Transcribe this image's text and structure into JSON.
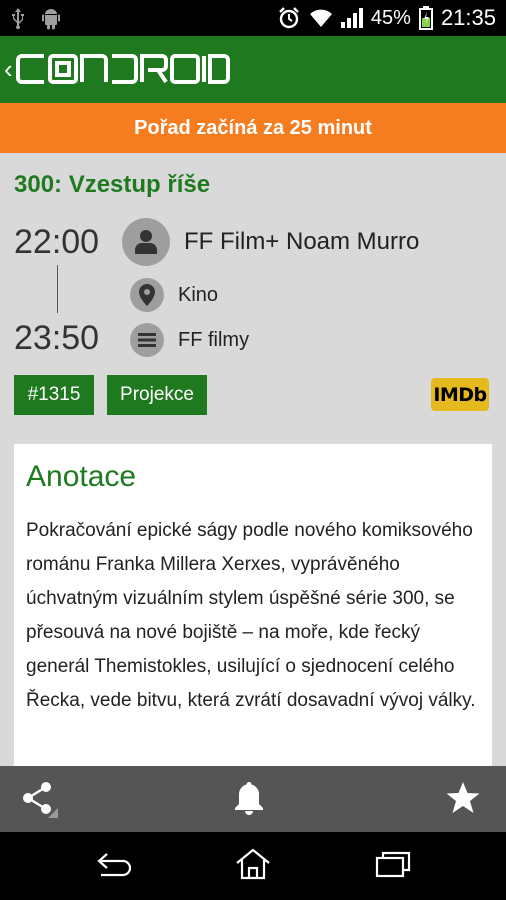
{
  "status_bar": {
    "battery_percent": "45%",
    "time": "21:35",
    "icons": [
      "usb-icon",
      "android-icon",
      "alarm-icon",
      "wifi-icon",
      "signal-icon",
      "battery-icon"
    ]
  },
  "app_bar": {
    "logo_text": "CONDROID"
  },
  "notice": {
    "text": "Pořad začíná za 25 minut"
  },
  "event": {
    "title": "300: Vzestup říše",
    "start_time": "22:00",
    "end_time": "23:50",
    "speaker": "FF Film+ Noam Murro",
    "location": "Kino",
    "category": "FF filmy",
    "tags": [
      "#1315",
      "Projekce"
    ],
    "imdb_label": "IMDb"
  },
  "annotation": {
    "heading": "Anotace",
    "text": "Pokračování epické ságy podle nového komiksového románu Franka Millera Xerxes, vyprávěného úchvatným vizuálním stylem úspěšné série 300, se přesouvá na nové bojiště – na moře, kde řecký generál Themistokles, usilující o sjednocení celého Řecka, vede bitvu, která zvrátí dosavadní vývoj války."
  },
  "bottom_actions": {
    "items": [
      "share-icon",
      "bell-icon",
      "star-icon"
    ]
  },
  "nav": {
    "items": [
      "back-icon",
      "home-icon",
      "recent-apps-icon"
    ]
  },
  "colors": {
    "brand_green": "#1f7a1f",
    "notice_orange": "#f57c1f",
    "imdb_yellow": "#e6b91e"
  }
}
